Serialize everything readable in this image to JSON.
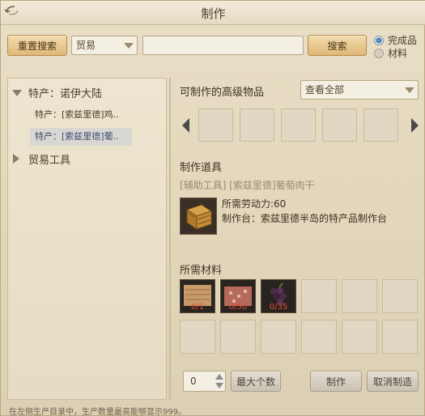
{
  "window": {
    "title": "制作"
  },
  "toolbar": {
    "reset_search_label": "重置搜索",
    "category_select_value": "贸易",
    "search_input_value": "",
    "search_button_label": "搜索",
    "radio_finished_label": "完成品",
    "radio_material_label": "材料",
    "selected_radio": "完成品"
  },
  "tree": {
    "group1_label": "特产：诺伊大陆",
    "item1_label": "特产：[索兹里德]鸡..",
    "item2_label": "特产：[索兹里德]葡..",
    "group2_label": "贸易工具"
  },
  "right": {
    "craftable_heading": "可制作的高级物品",
    "view_all_select": "查看全部",
    "craft_tool_heading": "制作道具",
    "craft_tool_name": "[辅助工具] [索兹里德]葡萄肉干",
    "labor_text": "所需劳动力:60",
    "station_text": "制作台：索兹里德半岛的特产品制作台",
    "materials_heading": "所需材料",
    "materials": [
      {
        "count": "0/1"
      },
      {
        "count": "0/50"
      },
      {
        "count": "0/35"
      }
    ]
  },
  "bottom": {
    "quantity_value": "0",
    "max_button_label": "最大个数",
    "craft_button_label": "制作",
    "cancel_button_label": "取消制造",
    "footer_note": "在左侧生产目录中，生产数量最高能够显示999。"
  },
  "colors": {
    "accent_button": "#e1b878",
    "panel_bg": "#e6dcc4",
    "selected_row": "#d8d7d2",
    "material_count_red": "#e24a3a"
  }
}
